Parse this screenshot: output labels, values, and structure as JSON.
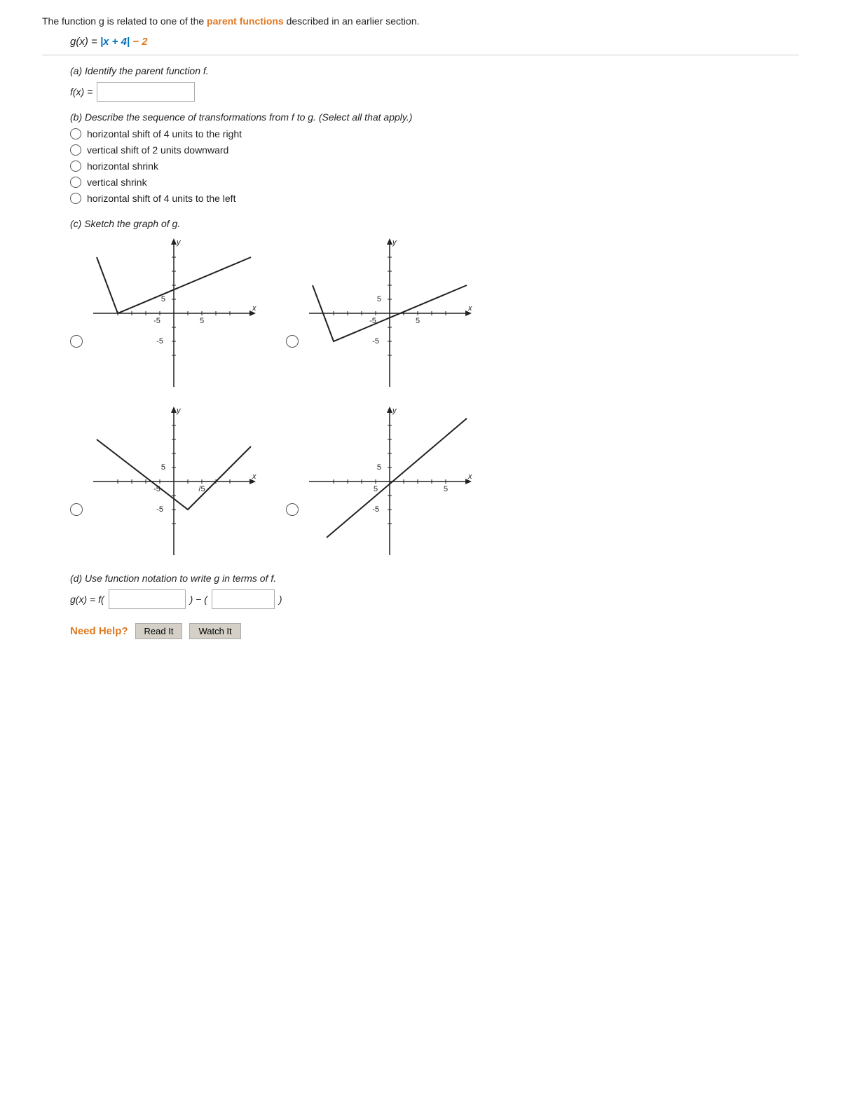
{
  "intro": {
    "text": "The function g is related to one of the ",
    "highlight": "parent functions",
    "text2": " described in an earlier section."
  },
  "equation": {
    "gx": "g(x) = |x + 4| − 2",
    "gx_parts": {
      "prefix": "g(x) = ",
      "abs_open": "|x ",
      "plus4": "+ 4",
      "abs_close": "|",
      "minus2": " − 2"
    }
  },
  "part_a": {
    "label": "(a) Identify the parent function f.",
    "fx_label": "f(x) = "
  },
  "part_b": {
    "label": "(b) Describe the sequence of transformations from f to g. (Select all that apply.)",
    "options": [
      "horizontal shift of 4 units to the right",
      "vertical shift of 2 units downward",
      "horizontal shrink",
      "vertical shrink",
      "horizontal shift of 4 units to the left"
    ]
  },
  "part_c": {
    "label": "(c) Sketch the graph of g."
  },
  "part_d": {
    "label": "(d) Use function notation to write g in terms of f.",
    "gx_label": "g(x) = f(",
    "mid": ") − (",
    "end": ")"
  },
  "need_help": {
    "label": "Need Help?",
    "read_it": "Read It",
    "watch_it": "Watch It"
  },
  "graphs": {
    "row1": [
      {
        "id": "g1",
        "type": "v_shape_centered",
        "description": "V-shape centered at -4, touching y≈0, going up on both sides"
      },
      {
        "id": "g2",
        "type": "v_shape_right",
        "description": "V-shape shifted right, asymmetric"
      }
    ],
    "row2": [
      {
        "id": "g3",
        "type": "v_shape_low",
        "description": "V-shape with vertex near (1,-2), going up"
      },
      {
        "id": "g4",
        "type": "linear_right",
        "description": "Linear going up from bottom-left"
      }
    ]
  }
}
